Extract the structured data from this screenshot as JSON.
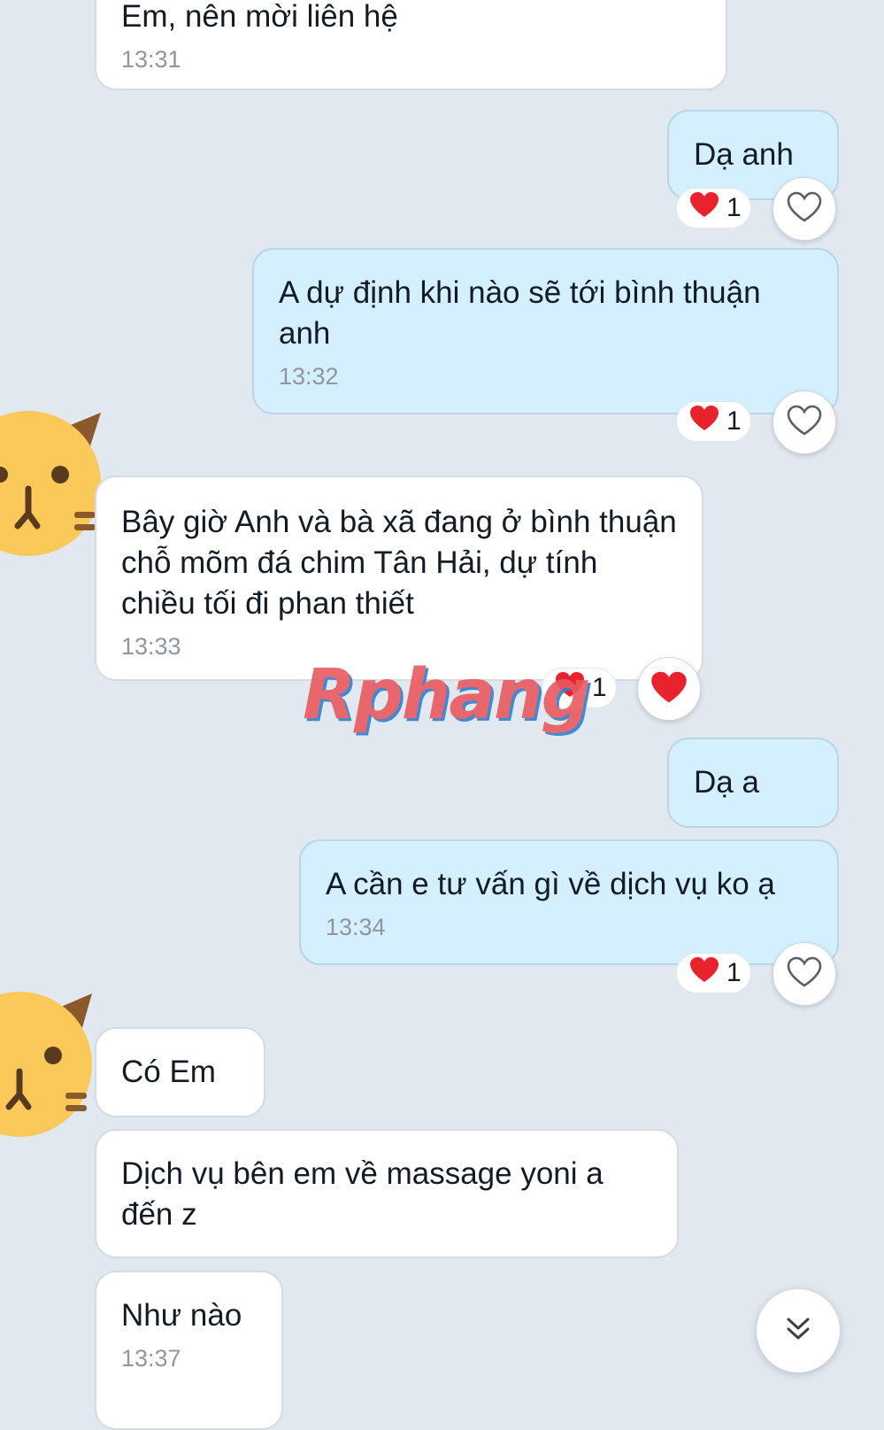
{
  "messages": [
    {
      "text": "Em, nên mời liên hệ",
      "time": "13:31"
    },
    {
      "text": "Dạ anh",
      "reaction_count": "1"
    },
    {
      "text": "A dự định khi nào sẽ tới bình thuận anh",
      "time": "13:32",
      "reaction_count": "1"
    },
    {
      "text": "Bây giờ Anh và bà xã đang ở bình thuận chỗ mõm đá chim Tân Hải, dự tính chiều tối đi phan thiết",
      "time": "13:33",
      "reaction_count": "1"
    },
    {
      "text": "Dạ a"
    },
    {
      "text": "A cần e tư vấn gì về dịch vụ ko ạ",
      "time": "13:34",
      "reaction_count": "1"
    },
    {
      "text": "Có Em"
    },
    {
      "text": "Dịch vụ bên em về massage yoni a đến z"
    },
    {
      "text": "Như nào",
      "time": "13:37"
    }
  ],
  "watermark": "Rphang",
  "icons": {
    "reaction": "red-heart-icon",
    "react_button": "heart-outline-icon",
    "scroll": "double-chevron-down-icon",
    "avatar": "cat-face-avatar"
  },
  "colors": {
    "background": "#e2e8f0",
    "incoming_bubble": "#ffffff",
    "outgoing_bubble": "#d4f0ff",
    "heart": "#e8232e",
    "avatar": "#fbc95a"
  }
}
